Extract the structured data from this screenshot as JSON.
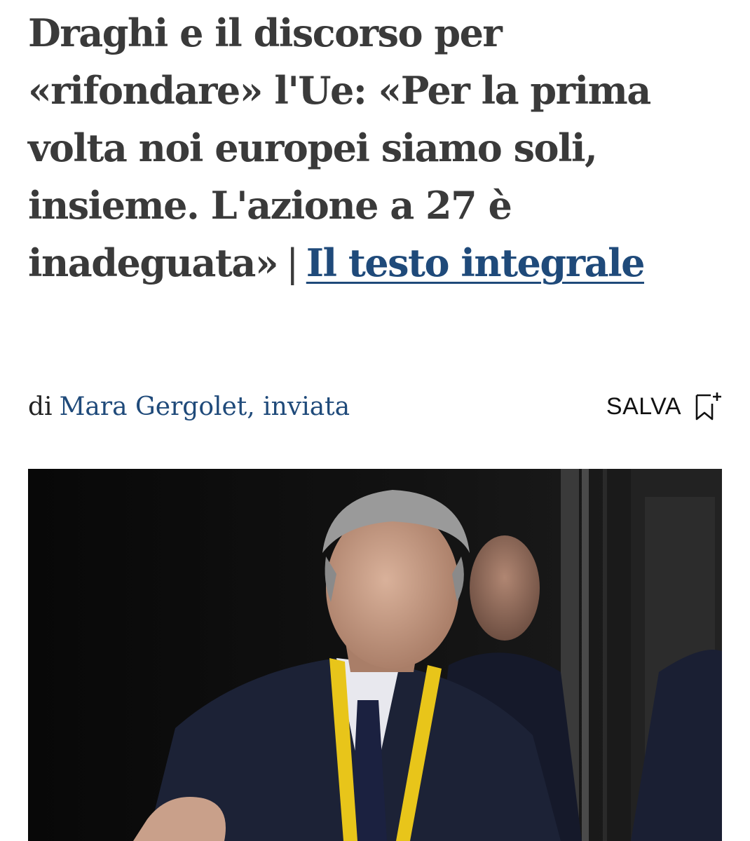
{
  "article": {
    "headline_text": "Draghi e il discorso per «rifondare» l'Ue: «Per la prima volta noi europei siamo soli, insieme. L'azione a 27 è inadeguata»",
    "headline_separator": "|",
    "full_text_link": "Il testo integrale",
    "byline_prefix": "di",
    "author": "Mara Gergolet, inviata",
    "save_label": "SALVA",
    "save_icon": "bookmark-add-icon"
  },
  "photo": {
    "subject": "news-photo",
    "colors": {
      "background": "#0d0d0d",
      "suit": "#1c2236",
      "lanyard": "#e8c51a",
      "skin": "#c9a08a",
      "hair": "#9a9a9a"
    }
  }
}
